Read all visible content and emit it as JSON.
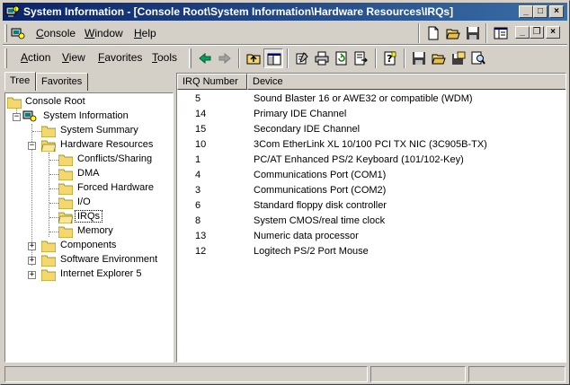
{
  "window": {
    "title": "System Information - [Console Root\\System Information\\Hardware Resources\\IRQs]",
    "title_controls": {
      "minimize": "_",
      "maximize": "□",
      "close": "×"
    }
  },
  "menubar": {
    "items": [
      "Console",
      "Window",
      "Help"
    ],
    "mdi_controls": {
      "minimize": "_",
      "restore": "❐",
      "close": "×"
    }
  },
  "actionbar": {
    "items": [
      "Action",
      "View",
      "Favorites",
      "Tools"
    ]
  },
  "tabs": [
    {
      "label": "Tree",
      "active": true
    },
    {
      "label": "Favorites",
      "active": false
    }
  ],
  "tree": {
    "expander_collapsed": "+",
    "expander_expanded": "−",
    "nodes": [
      {
        "label": "Console Root"
      },
      {
        "label": "System Information"
      },
      {
        "label": "System Summary"
      },
      {
        "label": "Hardware Resources"
      },
      {
        "label": "Conflicts/Sharing"
      },
      {
        "label": "DMA"
      },
      {
        "label": "Forced Hardware"
      },
      {
        "label": "I/O"
      },
      {
        "label": "IRQs"
      },
      {
        "label": "Memory"
      },
      {
        "label": "Components"
      },
      {
        "label": "Software Environment"
      },
      {
        "label": "Internet Explorer 5"
      }
    ]
  },
  "listview": {
    "columns": [
      "IRQ Number",
      "Device"
    ],
    "rows": [
      {
        "irq": "5",
        "device": "Sound Blaster 16 or AWE32 or compatible (WDM)"
      },
      {
        "irq": "14",
        "device": "Primary IDE Channel"
      },
      {
        "irq": "15",
        "device": "Secondary IDE Channel"
      },
      {
        "irq": "10",
        "device": "3Com EtherLink XL 10/100 PCI TX NIC (3C905B-TX)"
      },
      {
        "irq": "1",
        "device": "PC/AT Enhanced PS/2 Keyboard (101/102-Key)"
      },
      {
        "irq": "4",
        "device": "Communications Port (COM1)"
      },
      {
        "irq": "3",
        "device": "Communications Port (COM2)"
      },
      {
        "irq": "6",
        "device": "Standard floppy disk controller"
      },
      {
        "irq": "8",
        "device": "System CMOS/real time clock"
      },
      {
        "irq": "13",
        "device": "Numeric data processor"
      },
      {
        "irq": "12",
        "device": "Logitech PS/2 Port Mouse"
      }
    ]
  },
  "colors": {
    "titlebar_start": "#0a246a",
    "titlebar_end": "#3a6ea5",
    "chrome": "#d4d0c8",
    "folder": "#f5d76e"
  }
}
